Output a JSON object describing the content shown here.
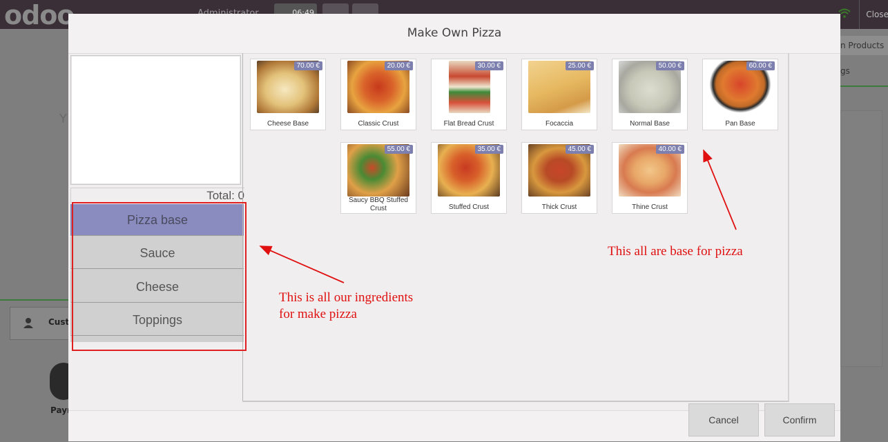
{
  "background": {
    "logo": "odoo",
    "admin_label": "Administrator",
    "clock": "06:49",
    "close_label": "Close",
    "products_label": "n Products",
    "gs_label": "gs",
    "y_label": "Y",
    "customer_label": "Cust",
    "payment_label": "Payr"
  },
  "modal": {
    "title": "Make Own Pizza",
    "total_label": "Total: 0",
    "categories": [
      {
        "label": "Pizza base",
        "active": true
      },
      {
        "label": "Sauce",
        "active": false
      },
      {
        "label": "Cheese",
        "active": false
      },
      {
        "label": "Toppings",
        "active": false
      }
    ],
    "products": [
      {
        "name": "Cheese Base",
        "price": "70.00 €"
      },
      {
        "name": "Classic Crust",
        "price": "20.00 €"
      },
      {
        "name": "Flat Bread Crust",
        "price": "30.00 €"
      },
      {
        "name": "Focaccia",
        "price": "25.00 €"
      },
      {
        "name": "Normal Base",
        "price": "50.00 €"
      },
      {
        "name": "Pan Base",
        "price": "60.00 €"
      },
      {
        "name": "Saucy BBQ Stuffed Crust",
        "price": "55.00 €"
      },
      {
        "name": "Stuffed Crust",
        "price": "35.00 €"
      },
      {
        "name": "Thick Crust",
        "price": "45.00 €"
      },
      {
        "name": "Thine Crust",
        "price": "40.00 €"
      }
    ],
    "cancel_label": "Cancel",
    "confirm_label": "Confirm"
  },
  "annotations": {
    "ingredients_line1": "This is all our ingredients",
    "ingredients_line2": "for make pizza",
    "bases_text": "This all are base for pizza",
    "color": "#e01010"
  }
}
